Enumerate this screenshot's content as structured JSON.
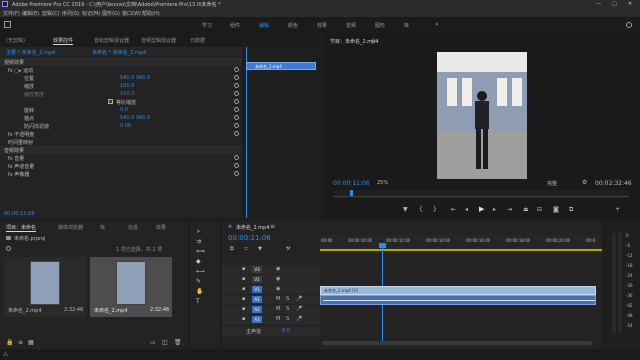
{
  "window": {
    "title": "Adobe Premiere Pro CC 2019 - C:\\用户\\lenovo\\文档\\Adobe\\Premiere Pro\\13.0\\未命名 *"
  },
  "menu": [
    "文件(F)",
    "编辑(E)",
    "剪辑(C)",
    "序列(S)",
    "标记(M)",
    "图形(G)",
    "窗口(W)",
    "帮助(H)"
  ],
  "workspaces": [
    "学习",
    "组件",
    "编辑",
    "颜色",
    "效果",
    "音频",
    "图形",
    "库"
  ],
  "workspace_active": 2,
  "fx_panel": {
    "tabs": [
      "(无剪辑)",
      "效果控件",
      "音轨剪辑混合器",
      "音频剪辑混合器",
      "元数据"
    ],
    "active_tab": 1,
    "source_label": "主要 * 未命名_2.mp4",
    "seq_label": "未命名 * 未命名_2.mp4",
    "sections": [
      {
        "label": "视频效果"
      },
      {
        "label": "fx ▢▸ 运动"
      },
      {
        "label": "位置",
        "value": "540.0   960.0"
      },
      {
        "label": "缩放",
        "value": "100.0"
      },
      {
        "label": "缩放宽度",
        "value": "100.0"
      },
      {
        "label": "等比缩放"
      },
      {
        "label": "旋转",
        "value": "0.0"
      },
      {
        "label": "锚点",
        "value": "540.0   960.0"
      },
      {
        "label": "防闪烁滤镜",
        "value": "0.00"
      },
      {
        "label": "fx 不透明度"
      },
      {
        "label": "时间重映射"
      },
      {
        "label": "音频效果"
      },
      {
        "label": "fx 音量"
      },
      {
        "label": "fx 声道音量"
      },
      {
        "label": "fx 声像器"
      }
    ],
    "clip_label": "未命名_2.mp4",
    "timecode": "00:00:11:06"
  },
  "program": {
    "title": "节目：未命名_2.mp4",
    "timecode": "00:00:11:06",
    "fit": "25%",
    "quality": "完整",
    "duration": "00:02:32:46"
  },
  "project": {
    "tabs": [
      "项目：未命名",
      "媒体浏览器",
      "库",
      "信息",
      "效果"
    ],
    "name": "未命名.prproj",
    "count": "1 项已选择，共 2 项",
    "items": [
      {
        "name": "未命名_2.mp4",
        "duration": "2:32:46"
      },
      {
        "name": "未命名_2.mp4",
        "duration": "2:32:46"
      }
    ]
  },
  "sequence": {
    "title": "未命名_2.mp4",
    "timecode": "00:00:11:06",
    "ruler": [
      "00:00",
      "00:00:10:00",
      "00:00:12:00",
      "00:00:14:00",
      "00:00:16:00",
      "00:00:18:00",
      "00:00:20:00",
      "00:0"
    ],
    "tracks": [
      "V3",
      "V2",
      "V1",
      "A1",
      "A2",
      "A3"
    ],
    "master": "主声道",
    "master_value": "0.0",
    "video_clip_label": "未命名_2.mp4 [V]"
  },
  "meters": [
    "0",
    "-6",
    "-12",
    "-18",
    "-24",
    "-30",
    "-36",
    "-42",
    "-48",
    "-54"
  ],
  "status": {
    "text": ""
  }
}
